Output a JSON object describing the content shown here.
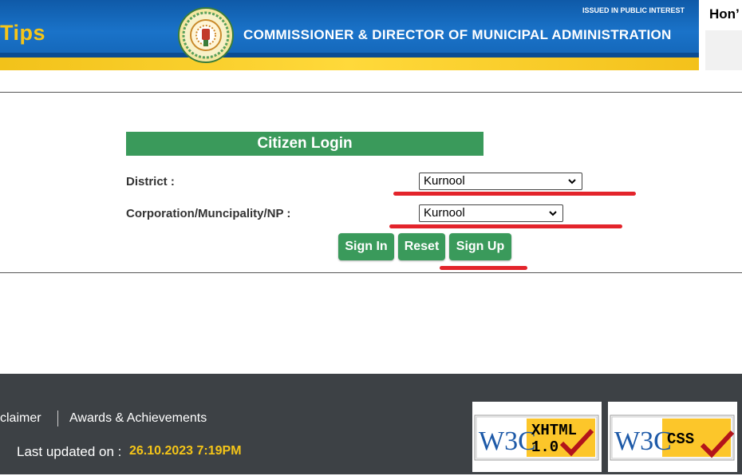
{
  "header": {
    "tips_text": "Tips",
    "title": "COMMISSIONER & DIRECTOR OF MUNICIPAL ADMINISTRATION",
    "issued_text": "ISSUED IN PUBLIC INTEREST",
    "side_text": "Hon’",
    "colors": {
      "blue": "#1466b8",
      "yellow": "#ffd93a"
    }
  },
  "login": {
    "title": "Citizen Login",
    "district_label": "District :",
    "district_value": "Kurnool",
    "corporation_label": "Corporation/Muncipality/NP :",
    "corporation_value": "Kurnool",
    "buttons": {
      "sign_in": "Sign In",
      "reset": "Reset",
      "sign_up": "Sign Up"
    },
    "accent_color": "#3a9a5b",
    "highlight_color": "#e3242b"
  },
  "footer": {
    "disclaimer_link": "claimer",
    "awards_link": "Awards & Achievements",
    "last_updated_label": "Last updated on :",
    "last_updated_value": "26.10.2023 7:19PM",
    "badges": {
      "xhtml": {
        "w3c": "W3C",
        "name": "XHTML",
        "version": "1.0"
      },
      "css": {
        "w3c": "W3C",
        "name": "CSS"
      }
    }
  }
}
